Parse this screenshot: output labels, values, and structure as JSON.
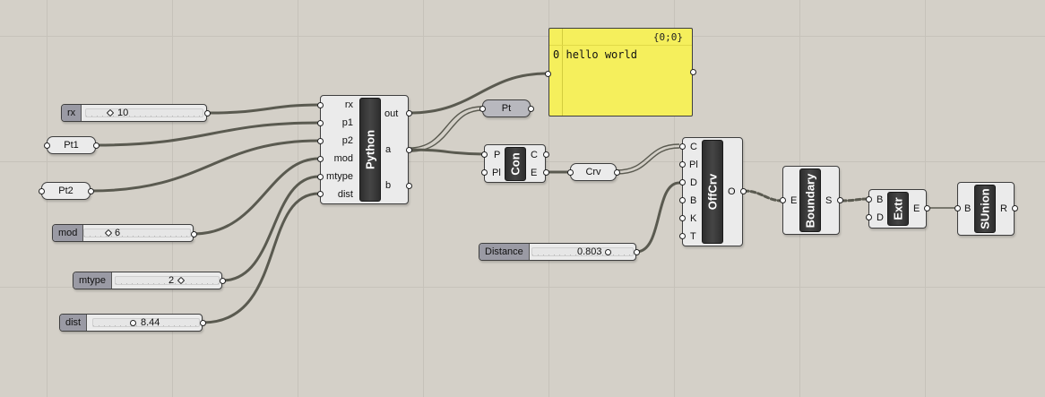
{
  "canvas": {
    "background": "#d4d0c8",
    "wire_color": "#5a5a50"
  },
  "sliders": {
    "rx": {
      "label": "rx",
      "value": "10"
    },
    "mod": {
      "label": "mod",
      "value": "6"
    },
    "mtype": {
      "label": "mtype",
      "value": "2"
    },
    "dist": {
      "label": "dist",
      "value": "8.44"
    },
    "distance": {
      "label": "Distance",
      "value": "0.803"
    }
  },
  "params": {
    "pt1": "Pt1",
    "pt2": "Pt2",
    "pt": "Pt",
    "crv": "Crv"
  },
  "python": {
    "title": "Python",
    "inputs": [
      "rx",
      "p1",
      "p2",
      "mod",
      "mtype",
      "dist"
    ],
    "outputs": [
      "out",
      "a",
      "b"
    ]
  },
  "panel": {
    "header": "{0;0}",
    "index": "0",
    "text": "hello world",
    "color": "#f5ef5c"
  },
  "con": {
    "title": "Con",
    "inputs": [
      "P",
      "Pl"
    ],
    "outputs": [
      "C",
      "E"
    ]
  },
  "offcrv": {
    "title": "OffCrv",
    "inputs": [
      "C",
      "Pl",
      "D",
      "B",
      "K",
      "T"
    ],
    "outputs": [
      "O"
    ]
  },
  "boundary": {
    "title": "Boundary",
    "inputs": [
      "E"
    ],
    "outputs": [
      "S"
    ]
  },
  "extr": {
    "title": "Extr",
    "inputs": [
      "B",
      "D"
    ],
    "outputs": [
      "E"
    ]
  },
  "sunion": {
    "title": "SUnion",
    "inputs": [
      "B"
    ],
    "outputs": [
      "R"
    ]
  }
}
